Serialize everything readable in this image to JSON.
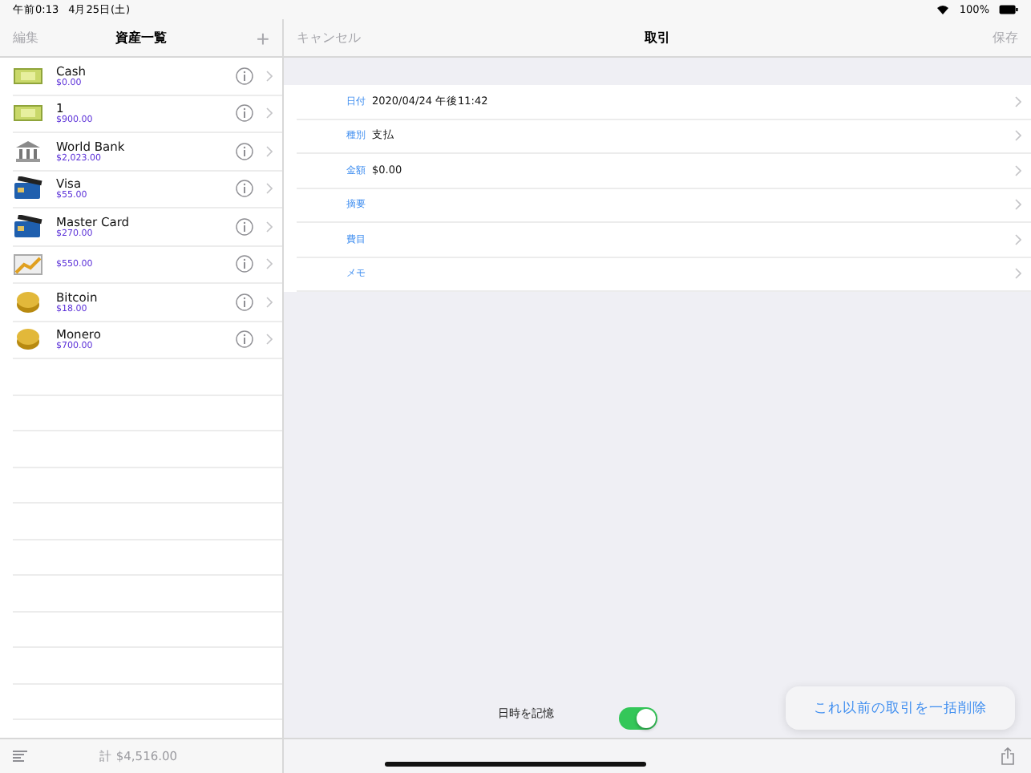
{
  "status_bar": {
    "time": "午前0:13",
    "date": "4月25日(土)",
    "battery": "100%"
  },
  "assets_panel": {
    "edit": "編集",
    "title": "資産一覧",
    "add": "+",
    "items": [
      {
        "kind": "cash",
        "name": "Cash",
        "amount": "$0.00"
      },
      {
        "kind": "cash",
        "name": "1",
        "amount": "$900.00"
      },
      {
        "kind": "bank",
        "name": "World Bank",
        "amount": "$2,023.00"
      },
      {
        "kind": "card",
        "name": "Visa",
        "amount": "$55.00"
      },
      {
        "kind": "card",
        "name": "Master Card",
        "amount": "$270.00"
      },
      {
        "kind": "chart",
        "amount": "$550.00"
      },
      {
        "kind": "coin",
        "name": "Bitcoin",
        "amount": "$18.00"
      },
      {
        "kind": "coin",
        "name": "Monero",
        "amount": "$700.00"
      }
    ],
    "total": "計 $4,516.00"
  },
  "transaction": {
    "cancel": "キャンセル",
    "title": "取引",
    "save": "保存",
    "fields": [
      {
        "label": "日付",
        "value": "2020/04/24 午後11:42"
      },
      {
        "label": "種別",
        "value": "支払"
      },
      {
        "label": "金額",
        "value": "$0.00"
      },
      {
        "label": "摘要"
      },
      {
        "label": "費目"
      },
      {
        "label": "メモ"
      }
    ],
    "remember": {
      "label": "日時を記憶",
      "on": true
    },
    "popover": "これ以前の取引を一括削除"
  }
}
